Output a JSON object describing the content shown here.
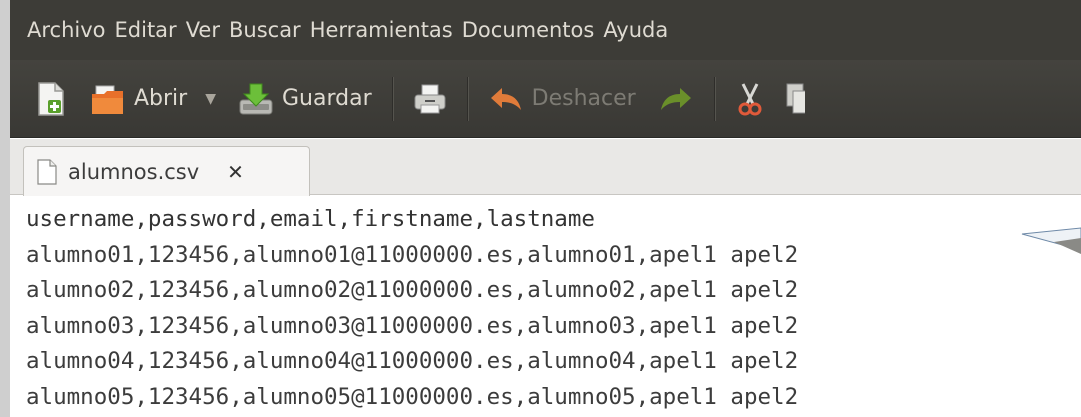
{
  "menubar": {
    "items": [
      "Archivo",
      "Editar",
      "Ver",
      "Buscar",
      "Herramientas",
      "Documentos",
      "Ayuda"
    ]
  },
  "toolbar": {
    "new_icon": "new-document-icon",
    "open_label": "Abrir",
    "save_label": "Guardar",
    "print_icon": "printer-icon",
    "undo_label": "Deshacer",
    "redo_icon": "redo-icon",
    "cut_icon": "scissors-icon",
    "copy_icon": "copy-icon"
  },
  "tab": {
    "filename": "alumnos.csv",
    "close_glyph": "✕"
  },
  "editor": {
    "lines": [
      "username,password,email,firstname,lastname",
      "alumno01,123456,alumno01@11000000.es,alumno01,apel1 apel2",
      "alumno02,123456,alumno02@11000000.es,alumno02,apel1 apel2",
      "alumno03,123456,alumno03@11000000.es,alumno03,apel1 apel2",
      "alumno04,123456,alumno04@11000000.es,alumno04,apel1 apel2",
      "alumno05,123456,alumno05@11000000.es,alumno05,apel1 apel2"
    ]
  },
  "colors": {
    "menubar_bg": "#3d3c37",
    "toolbar_bg": "#41403b",
    "menu_text": "#dfdbd2",
    "undo_arrow": "#e07b3a",
    "redo_arrow": "#6a8f2a"
  }
}
